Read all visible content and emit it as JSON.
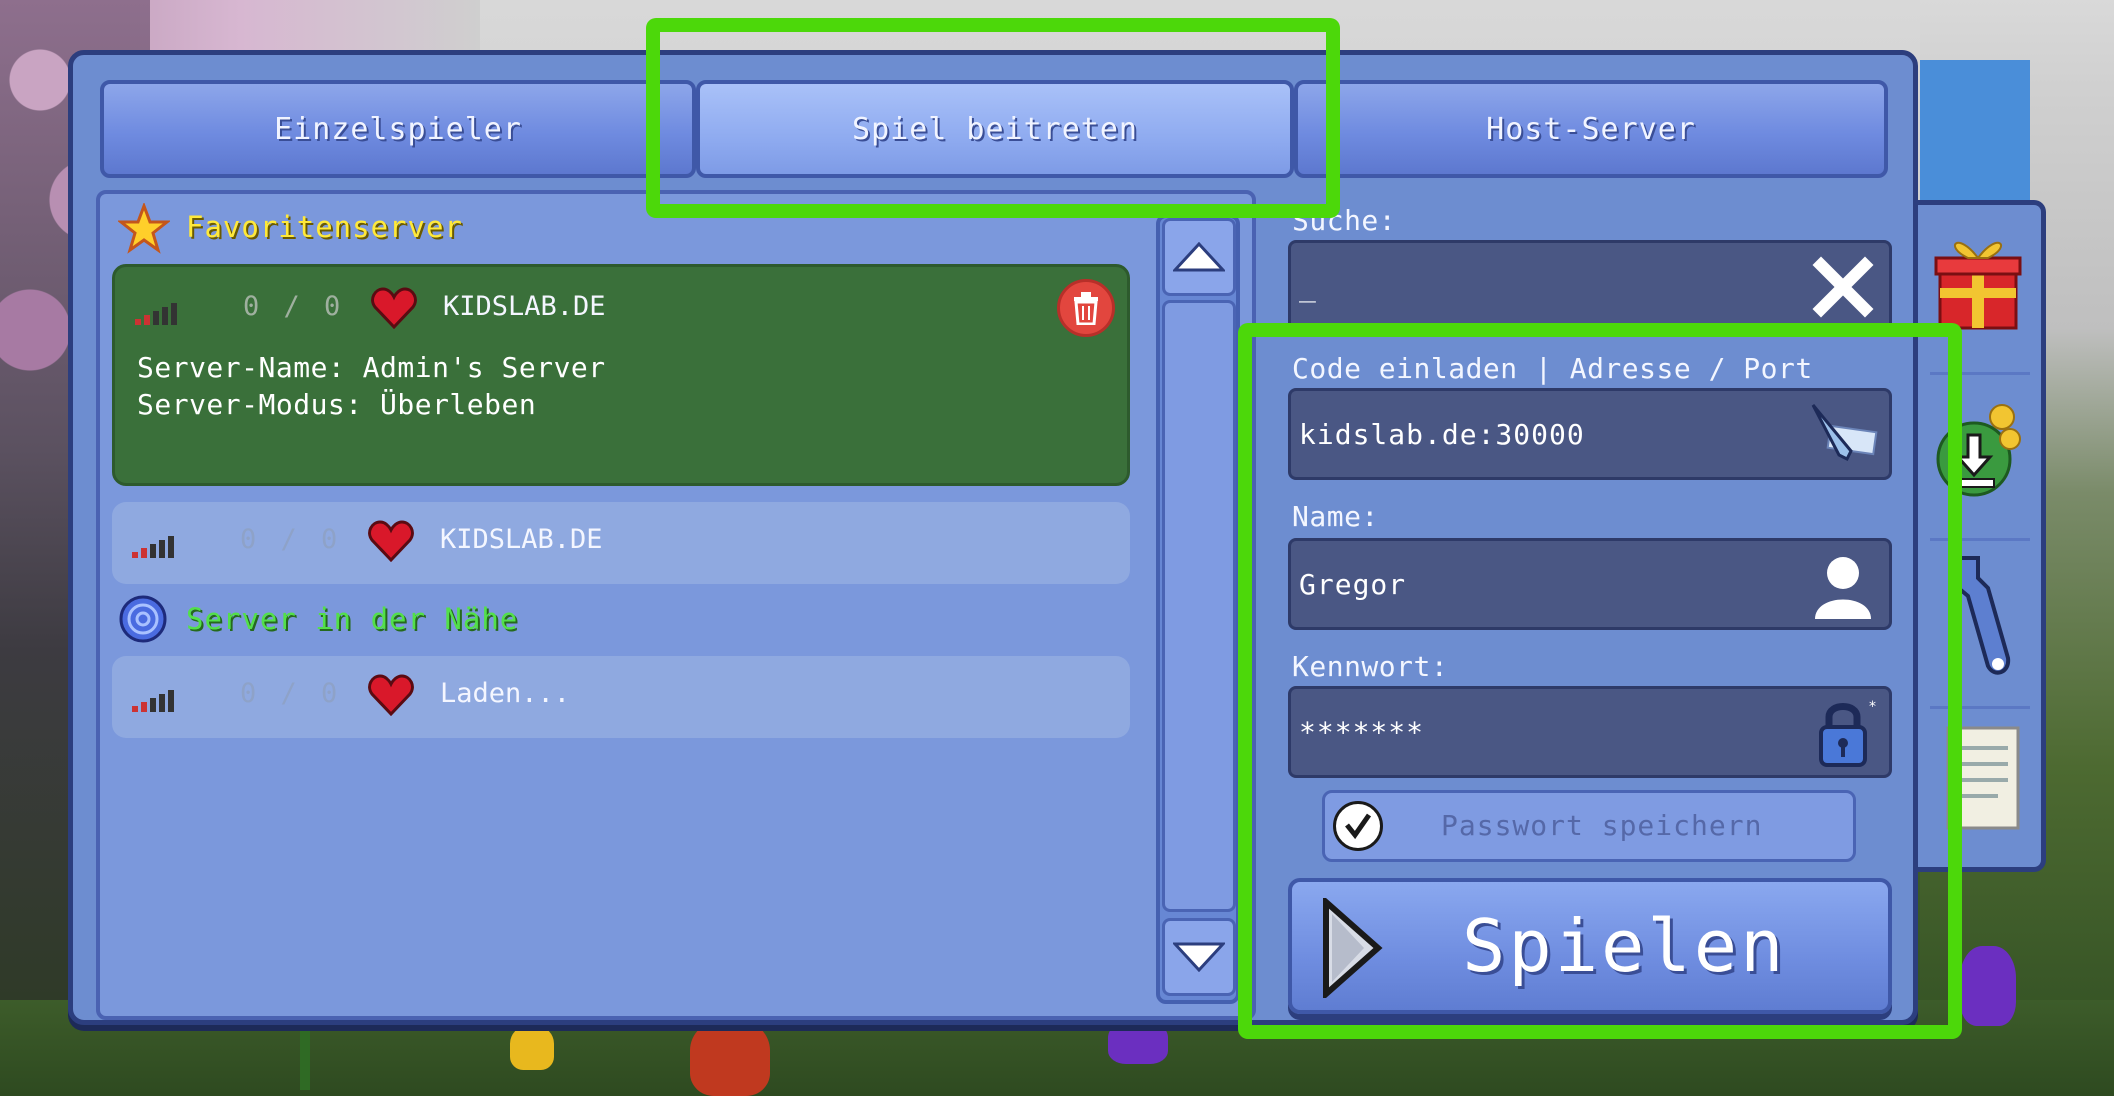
{
  "tabs": [
    {
      "label": "Einzelspieler",
      "active": false
    },
    {
      "label": "Spiel beitreten",
      "active": true
    },
    {
      "label": "Host-Server",
      "active": false
    }
  ],
  "favorites": {
    "title": "Favoritenserver",
    "servers": [
      {
        "players": "0 / 0",
        "name": "KIDSLAB.DE",
        "details": [
          "Server-Name: Admin's Server",
          "Server-Modus: Überleben"
        ],
        "selected": true
      },
      {
        "players": "0 / 0",
        "name": "KIDSLAB.DE",
        "selected": false
      }
    ]
  },
  "nearby": {
    "title": "Server in der Nähe",
    "servers": [
      {
        "players": "0 / 0",
        "name": "Laden..."
      }
    ]
  },
  "form": {
    "search_label": "Suche:",
    "search_value": "_",
    "address_label": "Code einladen | Adresse / Port",
    "address_value": "kidslab.de:30000",
    "name_label": "Name:",
    "name_value": "Gregor",
    "password_label": "Kennwort:",
    "password_value": "*******",
    "save_password_label": "Passwort speichern",
    "save_password_checked": true,
    "play_label": "Spielen"
  },
  "side_icons": [
    "gift-icon",
    "download-coins-icon",
    "wrench-icon",
    "notes-icon"
  ],
  "colors": {
    "highlight": "#4cd80a",
    "panel": "#6d8dd0",
    "selected_row": "#3a703a",
    "favorites_title": "#ffe93a",
    "nearby_title": "#53e04a"
  }
}
